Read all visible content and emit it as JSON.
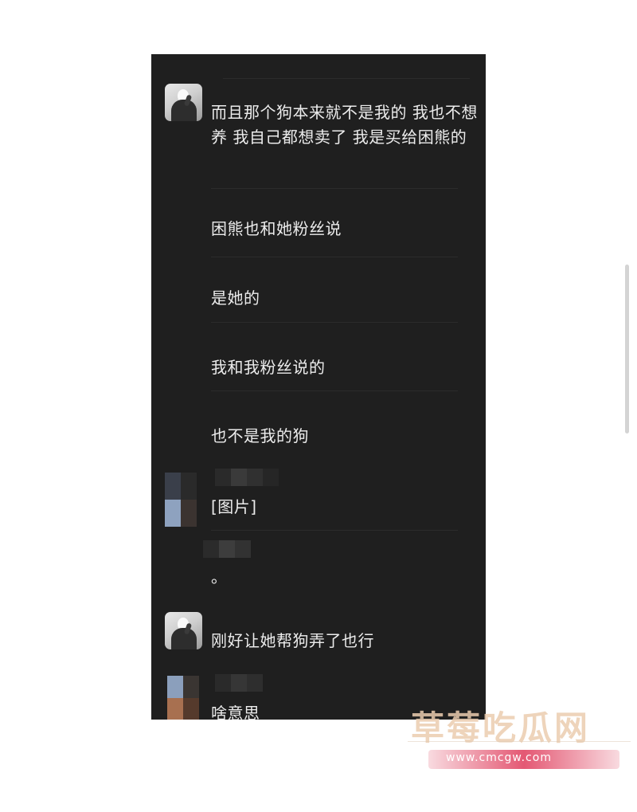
{
  "chat": {
    "messages": [
      {
        "id": "m1",
        "text": "而且那个狗本来就不是我的 我也不想养 我自己都想卖了 我是买给困熊的"
      },
      {
        "id": "m2",
        "text": "困熊也和她粉丝说"
      },
      {
        "id": "m3",
        "text": "是她的"
      },
      {
        "id": "m4",
        "text": "我和我粉丝说的"
      },
      {
        "id": "m5",
        "text": "也不是我的狗"
      },
      {
        "id": "m6",
        "text": "[图片]"
      },
      {
        "id": "m7",
        "text": "。"
      },
      {
        "id": "m8",
        "text": "刚好让她帮狗弄了也行"
      },
      {
        "id": "m9",
        "text": "啥意思"
      }
    ]
  },
  "watermark": {
    "title": "草莓吃瓜网",
    "url": "www.cmcgw.com"
  },
  "colors": {
    "chat_background": "#1f1f1f",
    "message_text": "#ececec",
    "page_background": "#ffffff",
    "watermark_title": "#ebcdaf",
    "watermark_url_band": "#e14664"
  },
  "icons": {
    "avatar_self": "avatar-photo",
    "avatar_other": "avatar-mosaic"
  }
}
